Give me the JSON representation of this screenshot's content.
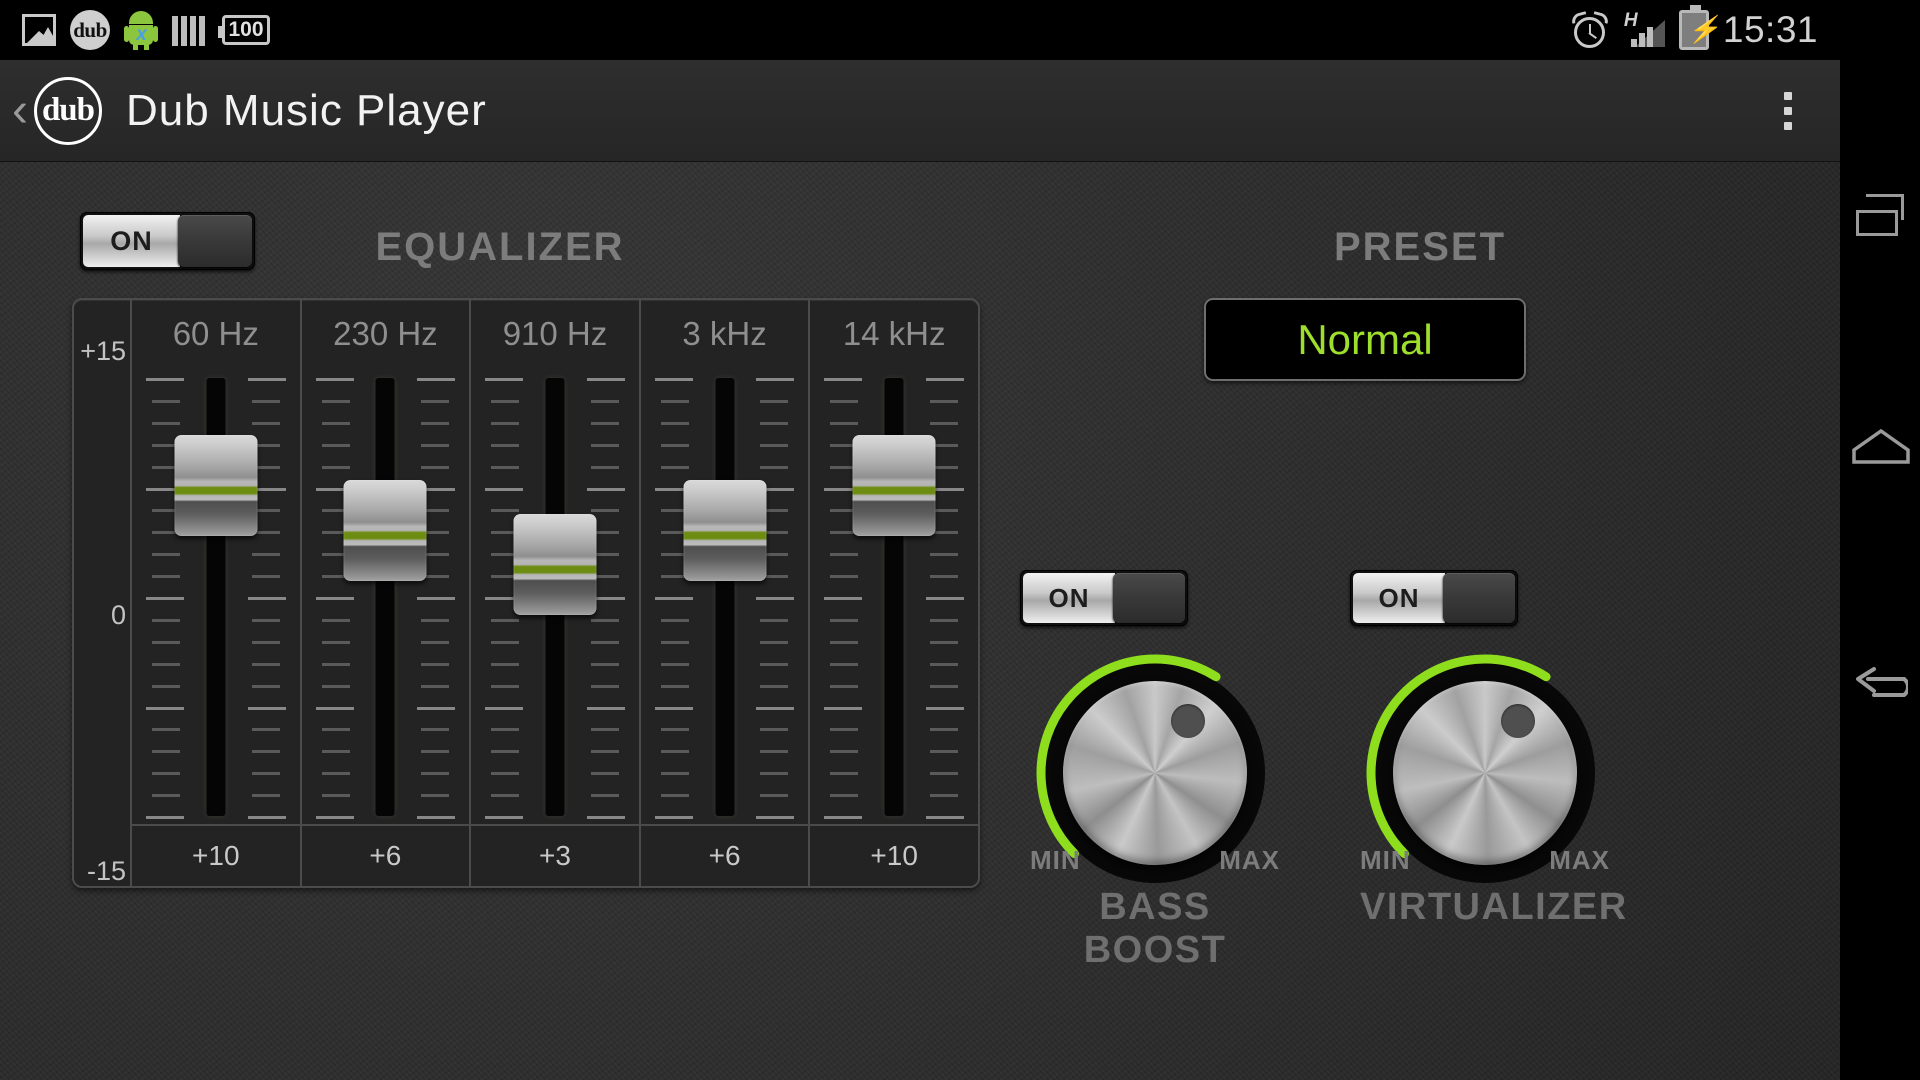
{
  "statusbar": {
    "icons_left": [
      "gallery-icon",
      "dub-app-icon",
      "android-icon",
      "bars-icon",
      "battery-100-icon"
    ],
    "dub_logo_text": "dub",
    "battery_percent": "100",
    "android_x": "x",
    "icons_right": [
      "alarm-icon",
      "signal-h-icon",
      "battery-charging-icon"
    ],
    "network_type": "H",
    "clock": "15:31"
  },
  "titlebar": {
    "back_label": "‹",
    "logo_text": "dub",
    "title": "Dub Music Player",
    "overflow_label": "more-options"
  },
  "equalizer": {
    "section_title": "EQUALIZER",
    "toggle_label": "ON",
    "toggle_state": "on",
    "scale": {
      "top": "+15",
      "mid": "0",
      "bottom": "-15"
    },
    "bands": [
      {
        "label": "60 Hz",
        "value": "+10",
        "gain": 10
      },
      {
        "label": "230 Hz",
        "value": "+6",
        "gain": 6
      },
      {
        "label": "910 Hz",
        "value": "+3",
        "gain": 3
      },
      {
        "label": "3 kHz",
        "value": "+6",
        "gain": 6
      },
      {
        "label": "14 kHz",
        "value": "+10",
        "gain": 10
      }
    ]
  },
  "preset": {
    "section_title": "PRESET",
    "selected": "Normal",
    "accent_color": "#9ede2c"
  },
  "effects": [
    {
      "name": "BASS BOOST",
      "toggle_label": "ON",
      "toggle_state": "on",
      "min_label": "MIN",
      "max_label": "MAX",
      "arc_color": "#8ede1e",
      "level_pct": 62
    },
    {
      "name": "VIRTUALIZER",
      "toggle_label": "ON",
      "toggle_state": "on",
      "min_label": "MIN",
      "max_label": "MAX",
      "arc_color": "#8ede1e",
      "level_pct": 62
    }
  ],
  "navbar": {
    "items": [
      {
        "name": "recent-apps",
        "icon": "recent-apps-icon"
      },
      {
        "name": "home",
        "icon": "home-icon"
      },
      {
        "name": "back",
        "icon": "back-arrow-icon"
      }
    ]
  }
}
